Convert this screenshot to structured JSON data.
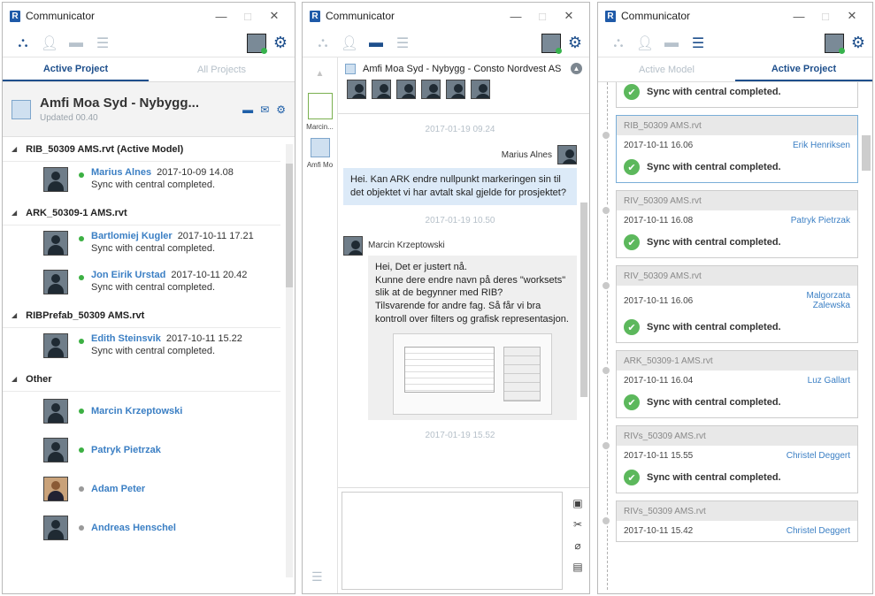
{
  "app_title": "Communicator",
  "window_controls": {
    "minimize": "—",
    "maximize": "□",
    "close": "✕"
  },
  "icons": {
    "app": "R",
    "gear": "⚙",
    "people": "⛬"
  },
  "window1": {
    "tabs": [
      {
        "label": "Active Project",
        "active": true
      },
      {
        "label": "All Projects",
        "active": false
      }
    ],
    "project": {
      "name": "Amfi Moa Syd - Nybygg...",
      "updated": "Updated 00.40"
    },
    "groups": [
      {
        "title": "RIB_50309 AMS.rvt (Active Model)",
        "members": [
          {
            "name": "Marius Alnes",
            "date": "2017-10-09 14.08",
            "status": "Sync with central completed.",
            "online": true
          }
        ]
      },
      {
        "title": "ARK_50309-1 AMS.rvt",
        "members": [
          {
            "name": "Bartlomiej Kugler",
            "date": "2017-10-11 17.21",
            "status": "Sync with central completed.",
            "online": true
          },
          {
            "name": "Jon Eirik Urstad",
            "date": "2017-10-11 20.42",
            "status": "Sync with central completed.",
            "online": true
          }
        ]
      },
      {
        "title": "RIBPrefab_50309 AMS.rvt",
        "members": [
          {
            "name": "Edith Steinsvik",
            "date": "2017-10-11 15.22",
            "status": "Sync with central completed.",
            "online": true
          }
        ]
      },
      {
        "title": "Other",
        "members": [
          {
            "name": "Marcin Krzeptowski",
            "online": true
          },
          {
            "name": "Patryk Pietrzak",
            "online": true
          },
          {
            "name": "Adam Peter",
            "online": false
          },
          {
            "name": "Andreas Henschel",
            "online": false
          }
        ]
      }
    ]
  },
  "window2": {
    "sidebar": [
      {
        "label": "Marcin..."
      },
      {
        "label": "Amfi Mo"
      }
    ],
    "chat_title": "Amfi Moa Syd - Nybygg  -  Consto Nordvest AS",
    "timestamps": [
      "2017-01-19 09.24",
      "2017-01-19 10.50",
      "2017-01-19 15.52"
    ],
    "messages": [
      {
        "author": "Marius Alnes",
        "text": "Hei. Kan ARK endre nullpunkt markeringen sin til det objektet vi har avtalt skal gjelde for prosjektet?"
      },
      {
        "author": "Marcin Krzeptowski",
        "text": "Hei, Det er justert nå.\nKunne dere endre navn på deres \"worksets\" slik at de begynner med RIB?\nTilsvarende for andre fag. Så får vi bra kontroll  over filters og grafisk representasjon."
      }
    ]
  },
  "window3": {
    "tabs": [
      {
        "label": "Active Model",
        "active": false
      },
      {
        "label": "Active Project",
        "active": true
      }
    ],
    "partial_status": "Sync with central completed.",
    "activities": [
      {
        "file": "RIB_50309 AMS.rvt",
        "date": "2017-10-11 16.06",
        "user": "Erik Henriksen",
        "status": "Sync with central completed."
      },
      {
        "file": "RIV_50309 AMS.rvt",
        "date": "2017-10-11 16.08",
        "user": "Patryk Pietrzak",
        "status": "Sync with central completed."
      },
      {
        "file": "RIV_50309 AMS.rvt",
        "date": "2017-10-11 16.06",
        "user": "Malgorzata Zalewska",
        "status": "Sync with central completed."
      },
      {
        "file": "ARK_50309-1 AMS.rvt",
        "date": "2017-10-11 16.04",
        "user": "Luz Gallart",
        "status": "Sync with central completed."
      },
      {
        "file": "RIVs_50309 AMS.rvt",
        "date": "2017-10-11 15.55",
        "user": "Christel Deggert",
        "status": "Sync with central completed."
      },
      {
        "file": "RIVs_50309 AMS.rvt",
        "date": "2017-10-11 15.42",
        "user": "Christel Deggert"
      }
    ]
  }
}
